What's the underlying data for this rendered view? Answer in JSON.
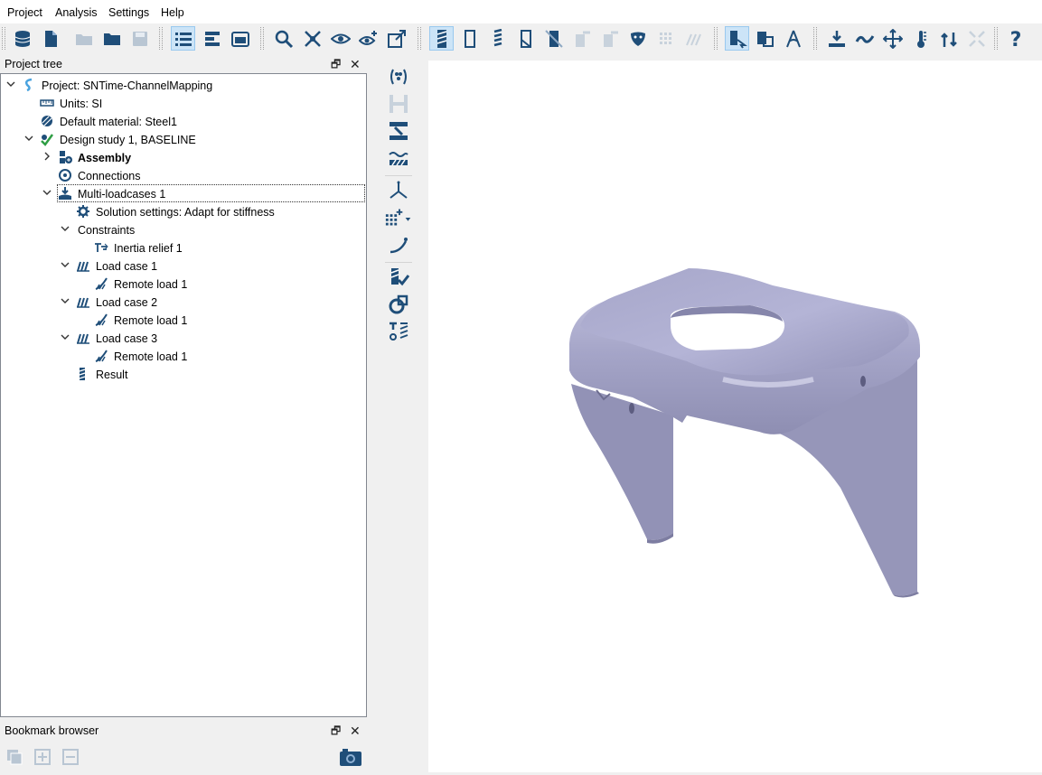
{
  "menubar": {
    "items": [
      "Project",
      "Analysis",
      "Settings",
      "Help"
    ]
  },
  "toolbar": {
    "groups": [
      [
        "database-icon",
        "new-file-icon",
        "open-folder-icon",
        "folder-icon",
        "save-icon"
      ],
      [
        "tree-list-icon",
        "bookmark-list-icon",
        "screenshot-icon"
      ],
      [
        "zoom-icon",
        "fit-icon",
        "view-eye-icon",
        "add-view-icon",
        "export-view-icon"
      ],
      [
        "shaded-icon",
        "outline-icon",
        "wireframe-icon",
        "section-icon",
        "clip-icon",
        "pin-icon",
        "pin2-icon",
        "mask-icon",
        "grid-icon",
        "hatch-icon"
      ],
      [
        "select-part-icon",
        "select-body-icon",
        "measure-icon"
      ],
      [
        "load-icon",
        "wave-icon",
        "move-icon",
        "thermometer-icon",
        "sensitivity-icon",
        "collapse-icon"
      ],
      [
        "help-icon"
      ]
    ]
  },
  "project_tree": {
    "title": "Project tree",
    "items": [
      {
        "label": "Project: SNTime-ChannelMapping",
        "icon": "project-icon",
        "level": 0,
        "expanded": true,
        "bold": false
      },
      {
        "label": "Units: SI",
        "icon": "ruler-icon",
        "level": 1,
        "bold": false
      },
      {
        "label": "Default material: Steel1",
        "icon": "material-icon",
        "level": 1,
        "bold": false
      },
      {
        "label": "Design study 1, BASELINE",
        "icon": "design-study-icon",
        "level": 1,
        "expanded": true,
        "bold": false
      },
      {
        "label": "Assembly",
        "icon": "assembly-icon",
        "level": 2,
        "expanded": false,
        "bold": true
      },
      {
        "label": "Connections",
        "icon": "connections-icon",
        "level": 2,
        "bold": false
      },
      {
        "label": "Multi-loadcases  1",
        "icon": "multi-loadcase-icon",
        "level": 2,
        "expanded": true,
        "bold": false,
        "selected": true
      },
      {
        "label": "Solution settings: Adapt for stiffness",
        "icon": "gear-icon",
        "level": 3,
        "bold": false
      },
      {
        "label": "Constraints",
        "icon": "",
        "level": 3,
        "expanded": true,
        "bold": false
      },
      {
        "label": "Inertia relief 1",
        "icon": "inertia-relief-icon",
        "level": 4,
        "bold": false
      },
      {
        "label": "Load case 1",
        "icon": "load-case-icon",
        "level": 3,
        "expanded": true,
        "bold": false
      },
      {
        "label": "Remote load 1",
        "icon": "remote-load-icon",
        "level": 4,
        "bold": false
      },
      {
        "label": "Load case 2",
        "icon": "load-case-icon",
        "level": 3,
        "expanded": true,
        "bold": false
      },
      {
        "label": "Remote load 1",
        "icon": "remote-load-icon",
        "level": 4,
        "bold": false
      },
      {
        "label": "Load case 3",
        "icon": "load-case-icon",
        "level": 3,
        "expanded": true,
        "bold": false
      },
      {
        "label": "Remote load 1",
        "icon": "remote-load-icon",
        "level": 4,
        "bold": false
      },
      {
        "label": "Result",
        "icon": "result-icon",
        "level": 3,
        "bold": false
      }
    ]
  },
  "bookmark_browser": {
    "title": "Bookmark browser"
  },
  "colors": {
    "accent": "#1f4e79",
    "selection": "#cce4f7",
    "model": "#9c9cc0"
  }
}
